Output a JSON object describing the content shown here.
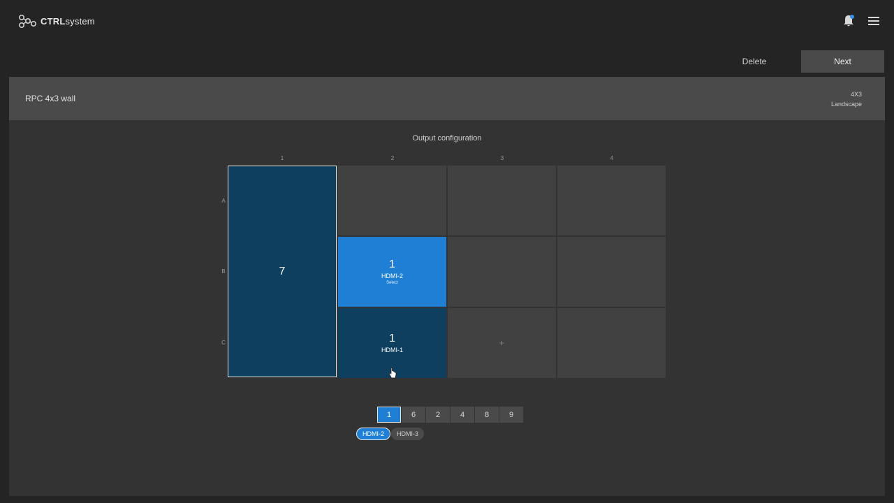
{
  "app": {
    "logo_bold": "CTRL",
    "logo_light": "system"
  },
  "icons": {
    "logo": "ctrl-logo-icon",
    "notifications": "bell-icon",
    "menu": "hamburger-menu-icon",
    "cursor": "hand-pointer-icon"
  },
  "colors": {
    "accent": "#1f7fd4",
    "assigned": "#0f3f5f",
    "notification_dot": "#3b8fe8"
  },
  "actions": {
    "delete_label": "Delete",
    "next_label": "Next"
  },
  "wall": {
    "name": "RPC 4x3 wall",
    "size": "4X3",
    "orientation": "Landscape"
  },
  "output": {
    "title": "Output configuration",
    "columns": [
      "1",
      "2",
      "3",
      "4"
    ],
    "rows": [
      "A",
      "B",
      "C"
    ],
    "tiles": [
      {
        "number": "7",
        "source": "",
        "span": "A1-C1"
      },
      {
        "number": "1",
        "source": "HDMI-2",
        "hint": "Select",
        "cell": "B2",
        "selected": true
      },
      {
        "number": "1",
        "source": "HDMI-1",
        "cell": "C2"
      }
    ],
    "add_symbol": "+"
  },
  "pages": [
    "1",
    "6",
    "2",
    "4",
    "8",
    "9"
  ],
  "active_page": "1",
  "sources": [
    "HDMI-2",
    "HDMI-3"
  ],
  "active_source": "HDMI-2"
}
